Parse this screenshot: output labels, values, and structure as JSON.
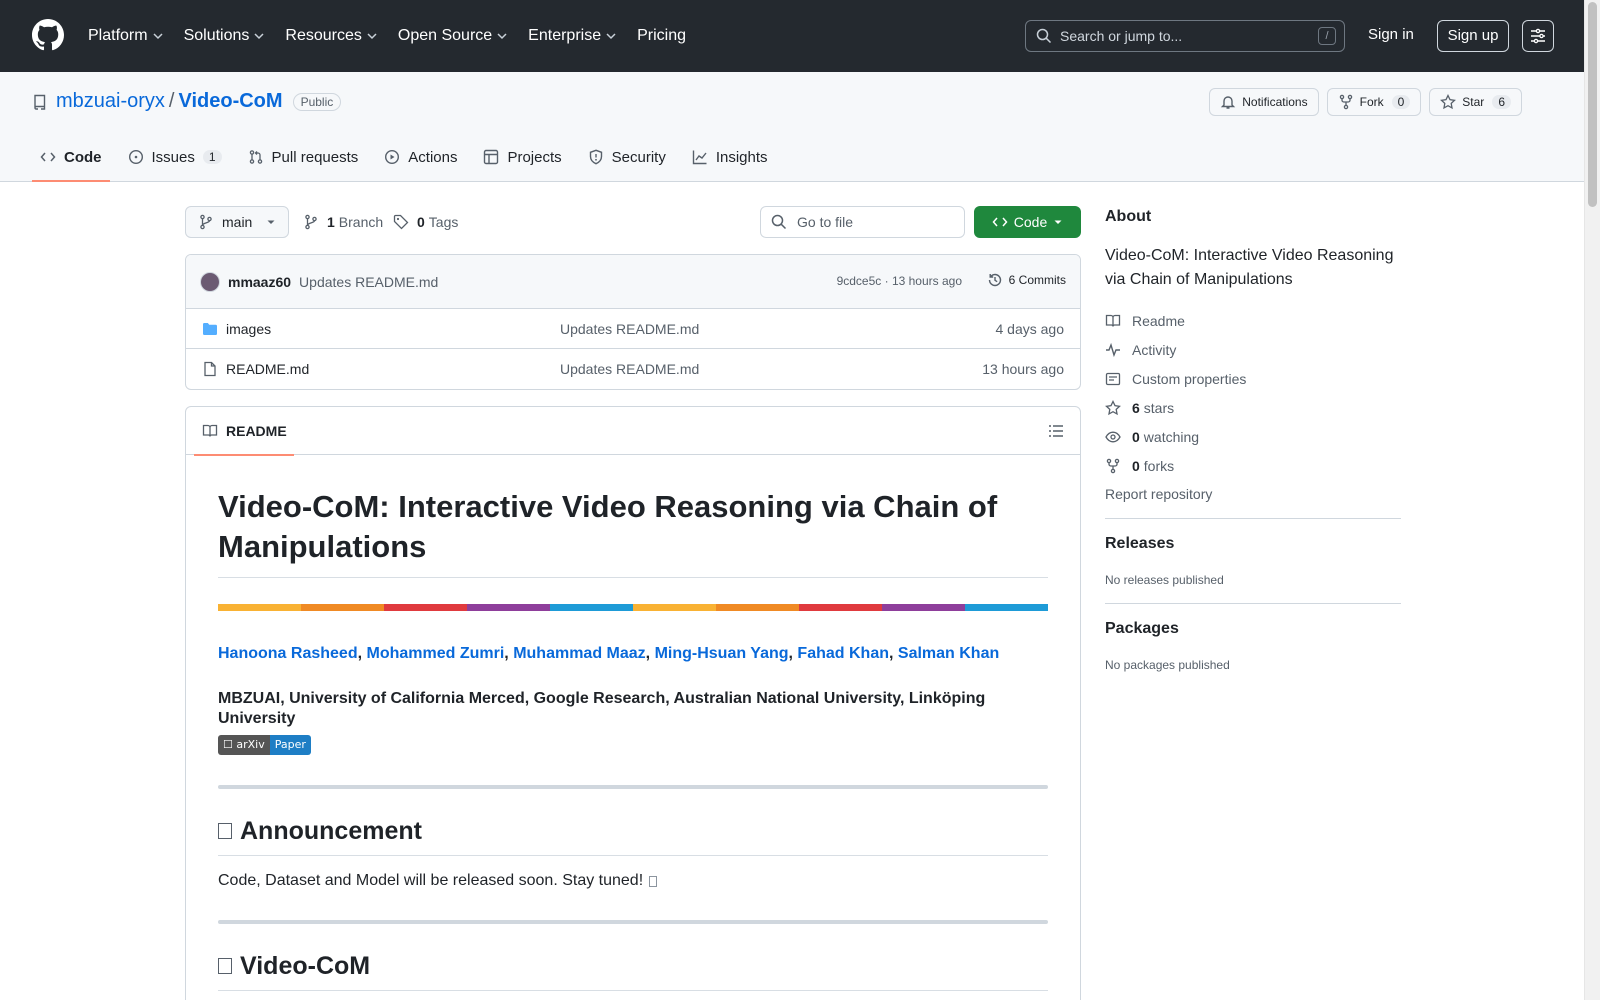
{
  "header": {
    "nav": [
      {
        "label": "Platform",
        "has_menu": true
      },
      {
        "label": "Solutions",
        "has_menu": true
      },
      {
        "label": "Resources",
        "has_menu": true
      },
      {
        "label": "Open Source",
        "has_menu": true
      },
      {
        "label": "Enterprise",
        "has_menu": true
      },
      {
        "label": "Pricing",
        "has_menu": false
      }
    ],
    "search_placeholder": "Search or jump to...",
    "search_shortcut": "/",
    "sign_in": "Sign in",
    "sign_up": "Sign up"
  },
  "repo": {
    "owner": "mbzuai-oryx",
    "separator": "/",
    "name": "Video-CoM",
    "visibility": "Public",
    "notifications_label": "Notifications",
    "fork_label": "Fork",
    "fork_count": "0",
    "star_label": "Star",
    "star_count": "6"
  },
  "tabs": {
    "code": "Code",
    "issues": "Issues",
    "issues_count": "1",
    "pulls": "Pull requests",
    "actions": "Actions",
    "projects": "Projects",
    "security": "Security",
    "insights": "Insights"
  },
  "filenav": {
    "branch": "main",
    "branch_count": "1",
    "branch_label": "Branch",
    "tag_count": "0",
    "tag_label": "Tags",
    "goto_placeholder": "Go to file",
    "code_button": "Code"
  },
  "commit": {
    "author": "mmaaz60",
    "message": "Updates README.md",
    "meta": "9cdce5c · 13 hours ago",
    "history": "6 Commits"
  },
  "files": [
    {
      "type": "folder",
      "name": "images",
      "message": "Updates README.md",
      "date": "4 days ago"
    },
    {
      "type": "file",
      "name": "README.md",
      "message": "Updates README.md",
      "date": "13 hours ago"
    }
  ],
  "readme": {
    "tab": "README",
    "title": "Video-CoM: Interactive Video Reasoning via Chain of Manipulations",
    "authors": [
      "Hanoona Rasheed",
      "Mohammed Zumri",
      "Muhammad Maaz",
      "Ming-Hsuan Yang",
      "Fahad Khan",
      "Salman Khan"
    ],
    "author_separator": ",",
    "affiliations": "MBZUAI, University of California Merced, Google Research, Australian National University, Linköping University",
    "badge_left": "☐ arXiv",
    "badge_right": "Paper",
    "section1_title": "Announcement",
    "section1_text": "Code, Dataset and Model will be released soon. Stay tuned!",
    "section2_title": "Video-CoM",
    "rainbow_colors": [
      "#f9b233",
      "#f08a24",
      "#e03a3e",
      "#8e3e9b",
      "#1e9bd7",
      "#f9b233",
      "#f08a24",
      "#e03a3e",
      "#8e3e9b",
      "#1e9bd7"
    ]
  },
  "about": {
    "heading": "About",
    "description": "Video-CoM: Interactive Video Reasoning via Chain of Manipulations",
    "readme": "Readme",
    "activity": "Activity",
    "custom_properties": "Custom properties",
    "stars_count": "6",
    "stars_label": "stars",
    "watching_count": "0",
    "watching_label": "watching",
    "forks_count": "0",
    "forks_label": "forks",
    "report": "Report repository"
  },
  "releases": {
    "heading": "Releases",
    "empty": "No releases published"
  },
  "packages": {
    "heading": "Packages",
    "empty": "No packages published"
  },
  "colors": {
    "header_bg": "#24292f",
    "link": "#0969da",
    "primary_button": "#1f883d",
    "tab_underline": "#fd8c73"
  }
}
